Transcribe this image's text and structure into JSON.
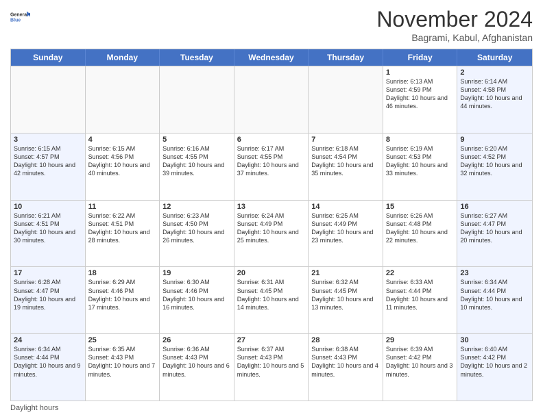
{
  "logo": {
    "text_general": "General",
    "text_blue": "Blue"
  },
  "title": "November 2024",
  "subtitle": "Bagrami, Kabul, Afghanistan",
  "header_days": [
    "Sunday",
    "Monday",
    "Tuesday",
    "Wednesday",
    "Thursday",
    "Friday",
    "Saturday"
  ],
  "footer_note": "Daylight hours",
  "weeks": [
    [
      {
        "day": "",
        "info": ""
      },
      {
        "day": "",
        "info": ""
      },
      {
        "day": "",
        "info": ""
      },
      {
        "day": "",
        "info": ""
      },
      {
        "day": "",
        "info": ""
      },
      {
        "day": "1",
        "info": "Sunrise: 6:13 AM\nSunset: 4:59 PM\nDaylight: 10 hours and 46 minutes."
      },
      {
        "day": "2",
        "info": "Sunrise: 6:14 AM\nSunset: 4:58 PM\nDaylight: 10 hours and 44 minutes."
      }
    ],
    [
      {
        "day": "3",
        "info": "Sunrise: 6:15 AM\nSunset: 4:57 PM\nDaylight: 10 hours and 42 minutes."
      },
      {
        "day": "4",
        "info": "Sunrise: 6:15 AM\nSunset: 4:56 PM\nDaylight: 10 hours and 40 minutes."
      },
      {
        "day": "5",
        "info": "Sunrise: 6:16 AM\nSunset: 4:55 PM\nDaylight: 10 hours and 39 minutes."
      },
      {
        "day": "6",
        "info": "Sunrise: 6:17 AM\nSunset: 4:55 PM\nDaylight: 10 hours and 37 minutes."
      },
      {
        "day": "7",
        "info": "Sunrise: 6:18 AM\nSunset: 4:54 PM\nDaylight: 10 hours and 35 minutes."
      },
      {
        "day": "8",
        "info": "Sunrise: 6:19 AM\nSunset: 4:53 PM\nDaylight: 10 hours and 33 minutes."
      },
      {
        "day": "9",
        "info": "Sunrise: 6:20 AM\nSunset: 4:52 PM\nDaylight: 10 hours and 32 minutes."
      }
    ],
    [
      {
        "day": "10",
        "info": "Sunrise: 6:21 AM\nSunset: 4:51 PM\nDaylight: 10 hours and 30 minutes."
      },
      {
        "day": "11",
        "info": "Sunrise: 6:22 AM\nSunset: 4:51 PM\nDaylight: 10 hours and 28 minutes."
      },
      {
        "day": "12",
        "info": "Sunrise: 6:23 AM\nSunset: 4:50 PM\nDaylight: 10 hours and 26 minutes."
      },
      {
        "day": "13",
        "info": "Sunrise: 6:24 AM\nSunset: 4:49 PM\nDaylight: 10 hours and 25 minutes."
      },
      {
        "day": "14",
        "info": "Sunrise: 6:25 AM\nSunset: 4:49 PM\nDaylight: 10 hours and 23 minutes."
      },
      {
        "day": "15",
        "info": "Sunrise: 6:26 AM\nSunset: 4:48 PM\nDaylight: 10 hours and 22 minutes."
      },
      {
        "day": "16",
        "info": "Sunrise: 6:27 AM\nSunset: 4:47 PM\nDaylight: 10 hours and 20 minutes."
      }
    ],
    [
      {
        "day": "17",
        "info": "Sunrise: 6:28 AM\nSunset: 4:47 PM\nDaylight: 10 hours and 19 minutes."
      },
      {
        "day": "18",
        "info": "Sunrise: 6:29 AM\nSunset: 4:46 PM\nDaylight: 10 hours and 17 minutes."
      },
      {
        "day": "19",
        "info": "Sunrise: 6:30 AM\nSunset: 4:46 PM\nDaylight: 10 hours and 16 minutes."
      },
      {
        "day": "20",
        "info": "Sunrise: 6:31 AM\nSunset: 4:45 PM\nDaylight: 10 hours and 14 minutes."
      },
      {
        "day": "21",
        "info": "Sunrise: 6:32 AM\nSunset: 4:45 PM\nDaylight: 10 hours and 13 minutes."
      },
      {
        "day": "22",
        "info": "Sunrise: 6:33 AM\nSunset: 4:44 PM\nDaylight: 10 hours and 11 minutes."
      },
      {
        "day": "23",
        "info": "Sunrise: 6:34 AM\nSunset: 4:44 PM\nDaylight: 10 hours and 10 minutes."
      }
    ],
    [
      {
        "day": "24",
        "info": "Sunrise: 6:34 AM\nSunset: 4:44 PM\nDaylight: 10 hours and 9 minutes."
      },
      {
        "day": "25",
        "info": "Sunrise: 6:35 AM\nSunset: 4:43 PM\nDaylight: 10 hours and 7 minutes."
      },
      {
        "day": "26",
        "info": "Sunrise: 6:36 AM\nSunset: 4:43 PM\nDaylight: 10 hours and 6 minutes."
      },
      {
        "day": "27",
        "info": "Sunrise: 6:37 AM\nSunset: 4:43 PM\nDaylight: 10 hours and 5 minutes."
      },
      {
        "day": "28",
        "info": "Sunrise: 6:38 AM\nSunset: 4:43 PM\nDaylight: 10 hours and 4 minutes."
      },
      {
        "day": "29",
        "info": "Sunrise: 6:39 AM\nSunset: 4:42 PM\nDaylight: 10 hours and 3 minutes."
      },
      {
        "day": "30",
        "info": "Sunrise: 6:40 AM\nSunset: 4:42 PM\nDaylight: 10 hours and 2 minutes."
      }
    ]
  ]
}
